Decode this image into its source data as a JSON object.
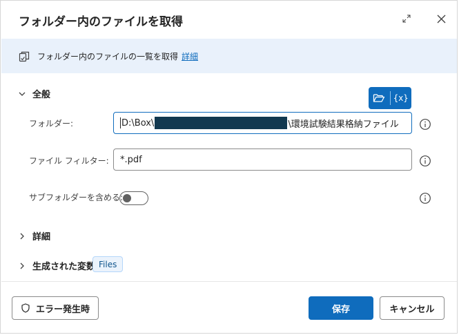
{
  "dialog": {
    "title": "フォルダー内のファイルを取得"
  },
  "info": {
    "text": "フォルダー内のファイルの一覧を取得",
    "link": "詳細"
  },
  "sections": {
    "general": "全般",
    "advanced": "詳細",
    "variables": "生成された変数"
  },
  "fields": {
    "folder_label": "フォルダー:",
    "folder_value_prefix": "D:\\Box\\",
    "folder_value_suffix": "\\環境試験結果格納ファイル",
    "filter_label": "ファイル フィルター:",
    "filter_value": "*.pdf",
    "subfolder_label": "サブフォルダーを含める:",
    "subfolder_on": false
  },
  "floatbar": {
    "variable_glyph": "{x}"
  },
  "variables": {
    "badge": "Files"
  },
  "footer": {
    "on_error": "エラー発生時",
    "save": "保存",
    "cancel": "キャンセル"
  },
  "colors": {
    "accent": "#0f6cbd",
    "infobar": "#e9f1fb",
    "redaction": "#12384f"
  },
  "icons": {
    "expand": "expand-icon",
    "close": "close-icon",
    "info_bar": "copy-document-icon",
    "folder_picker": "folder-open-icon",
    "variable": "variable-icon",
    "help": "info-circle-icon",
    "shield": "shield-icon"
  }
}
